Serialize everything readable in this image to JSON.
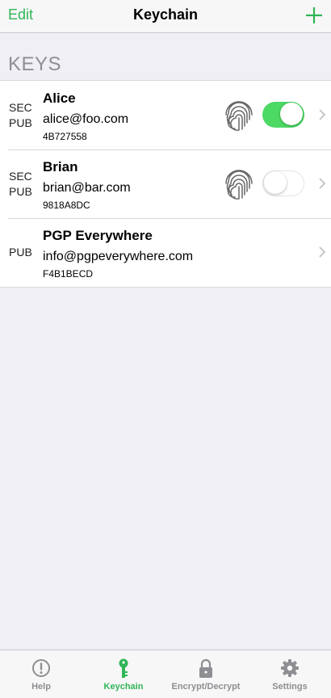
{
  "nav": {
    "edit_label": "Edit",
    "title": "Keychain",
    "add_icon": "plus-icon"
  },
  "section": {
    "header": "KEYS"
  },
  "keys": [
    {
      "type_lines": [
        "SEC",
        "PUB"
      ],
      "name": "Alice",
      "email": "alice@foo.com",
      "id": "4B727558",
      "touch_id": true
    },
    {
      "type_lines": [
        "SEC",
        "PUB"
      ],
      "name": "Brian",
      "email": "brian@bar.com",
      "id": "9818A8DC",
      "touch_id": false
    },
    {
      "type_lines": [
        "PUB"
      ],
      "name": "PGP Everywhere",
      "email": "info@pgpeverywhere.com",
      "id": "F4B1BECD"
    }
  ],
  "tabs": [
    {
      "label": "Help",
      "icon": "help-icon",
      "active": false
    },
    {
      "label": "Keychain",
      "icon": "key-icon",
      "active": true
    },
    {
      "label": "Encrypt/Decrypt",
      "icon": "lock-icon",
      "active": false
    },
    {
      "label": "Settings",
      "icon": "gear-icon",
      "active": false
    }
  ],
  "colors": {
    "accent": "#2fb556",
    "toggle_on": "#4cd964",
    "inactive": "#8e8e93"
  }
}
